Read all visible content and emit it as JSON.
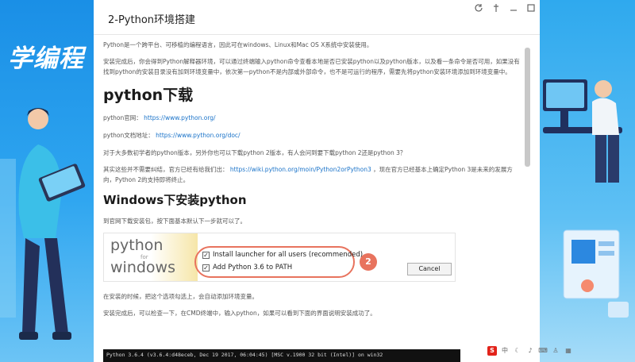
{
  "brand": {
    "text": "学编程"
  },
  "window": {
    "title": "2-Python环境搭建",
    "icons": [
      "refresh-icon",
      "pin-icon",
      "minimize-icon",
      "maximize-icon"
    ]
  },
  "content": {
    "intro": "Python是一个跨平台、可移植的编程语言，因此可在windows、Linux和Mac OS X系统中安装使用。",
    "intro2": "安装完成后，你会得到Python解释器环境，可以通过终端输入python命令查看本地是否已安装python以及python版本，以及看一条命令是否可用，如果没有找到python的安装目录没有加到环境变量中，依次第一python不是内部或外部命令，也不是可运行的程序，需要先将python安装环境添加到环境变量中。",
    "h_download": "python下载",
    "site_label": "python官网：",
    "site_url": "https://www.python.org/",
    "doc_label": "python文档地址：",
    "doc_url": "https://www.python.org/doc/",
    "note": "对于大多数初学者的python版本，另外你也可以下载python 2版本，有人会问到要下载python 2还是python 3？",
    "note2_a": "其实这些并不需要纠结，官方已经有给我们出：",
    "note2_url": "https://wiki.python.org/moin/Python2orPython3",
    "note2_b": "，现在官方已经基本上确定Python 3是未来的发展方向，Python 2的支持即将终止。",
    "h_windows": "Windows下安装python",
    "install_note": "到官网下载安装包，按下面基本默认下一步就可以了。",
    "installer": {
      "logo_python": "python",
      "logo_for": "for",
      "logo_windows": "windows",
      "opt1": "Install launcher for all users (recommended)",
      "opt2": "Add Python 3.6 to PATH",
      "badge": "2",
      "cancel": "Cancel"
    },
    "after1": "在安装的时候，把这个选项勾选上，会自动添加环境变量。",
    "after2": "安装完成后，可以检查一下，在CMD终端中，输入python，如果可以看到下面的界面说明安装成功了。",
    "terminal": "Python 3.6.4 (v3.6.4:d48eceb, Dec 19 2017, 06:04:45) [MSC v.1900 32 bit (Intel)] on win32"
  }
}
